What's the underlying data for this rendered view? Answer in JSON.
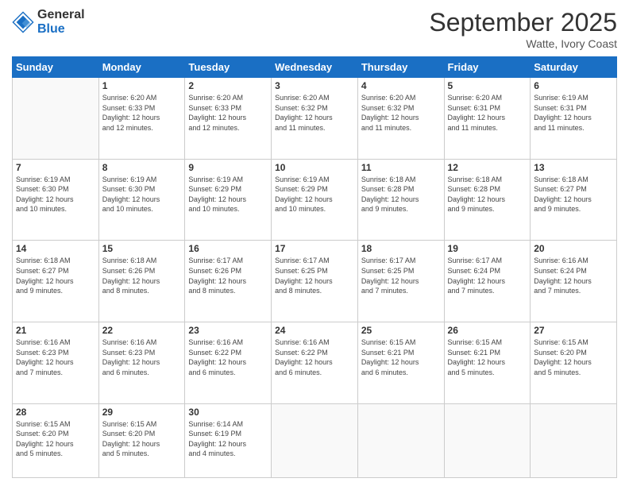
{
  "logo": {
    "general": "General",
    "blue": "Blue"
  },
  "header": {
    "title": "September 2025",
    "location": "Watte, Ivory Coast"
  },
  "weekdays": [
    "Sunday",
    "Monday",
    "Tuesday",
    "Wednesday",
    "Thursday",
    "Friday",
    "Saturday"
  ],
  "weeks": [
    [
      {
        "day": "",
        "info": ""
      },
      {
        "day": "1",
        "info": "Sunrise: 6:20 AM\nSunset: 6:33 PM\nDaylight: 12 hours\nand 12 minutes."
      },
      {
        "day": "2",
        "info": "Sunrise: 6:20 AM\nSunset: 6:33 PM\nDaylight: 12 hours\nand 12 minutes."
      },
      {
        "day": "3",
        "info": "Sunrise: 6:20 AM\nSunset: 6:32 PM\nDaylight: 12 hours\nand 11 minutes."
      },
      {
        "day": "4",
        "info": "Sunrise: 6:20 AM\nSunset: 6:32 PM\nDaylight: 12 hours\nand 11 minutes."
      },
      {
        "day": "5",
        "info": "Sunrise: 6:20 AM\nSunset: 6:31 PM\nDaylight: 12 hours\nand 11 minutes."
      },
      {
        "day": "6",
        "info": "Sunrise: 6:19 AM\nSunset: 6:31 PM\nDaylight: 12 hours\nand 11 minutes."
      }
    ],
    [
      {
        "day": "7",
        "info": "Sunrise: 6:19 AM\nSunset: 6:30 PM\nDaylight: 12 hours\nand 10 minutes."
      },
      {
        "day": "8",
        "info": "Sunrise: 6:19 AM\nSunset: 6:30 PM\nDaylight: 12 hours\nand 10 minutes."
      },
      {
        "day": "9",
        "info": "Sunrise: 6:19 AM\nSunset: 6:29 PM\nDaylight: 12 hours\nand 10 minutes."
      },
      {
        "day": "10",
        "info": "Sunrise: 6:19 AM\nSunset: 6:29 PM\nDaylight: 12 hours\nand 10 minutes."
      },
      {
        "day": "11",
        "info": "Sunrise: 6:18 AM\nSunset: 6:28 PM\nDaylight: 12 hours\nand 9 minutes."
      },
      {
        "day": "12",
        "info": "Sunrise: 6:18 AM\nSunset: 6:28 PM\nDaylight: 12 hours\nand 9 minutes."
      },
      {
        "day": "13",
        "info": "Sunrise: 6:18 AM\nSunset: 6:27 PM\nDaylight: 12 hours\nand 9 minutes."
      }
    ],
    [
      {
        "day": "14",
        "info": "Sunrise: 6:18 AM\nSunset: 6:27 PM\nDaylight: 12 hours\nand 9 minutes."
      },
      {
        "day": "15",
        "info": "Sunrise: 6:18 AM\nSunset: 6:26 PM\nDaylight: 12 hours\nand 8 minutes."
      },
      {
        "day": "16",
        "info": "Sunrise: 6:17 AM\nSunset: 6:26 PM\nDaylight: 12 hours\nand 8 minutes."
      },
      {
        "day": "17",
        "info": "Sunrise: 6:17 AM\nSunset: 6:25 PM\nDaylight: 12 hours\nand 8 minutes."
      },
      {
        "day": "18",
        "info": "Sunrise: 6:17 AM\nSunset: 6:25 PM\nDaylight: 12 hours\nand 7 minutes."
      },
      {
        "day": "19",
        "info": "Sunrise: 6:17 AM\nSunset: 6:24 PM\nDaylight: 12 hours\nand 7 minutes."
      },
      {
        "day": "20",
        "info": "Sunrise: 6:16 AM\nSunset: 6:24 PM\nDaylight: 12 hours\nand 7 minutes."
      }
    ],
    [
      {
        "day": "21",
        "info": "Sunrise: 6:16 AM\nSunset: 6:23 PM\nDaylight: 12 hours\nand 7 minutes."
      },
      {
        "day": "22",
        "info": "Sunrise: 6:16 AM\nSunset: 6:23 PM\nDaylight: 12 hours\nand 6 minutes."
      },
      {
        "day": "23",
        "info": "Sunrise: 6:16 AM\nSunset: 6:22 PM\nDaylight: 12 hours\nand 6 minutes."
      },
      {
        "day": "24",
        "info": "Sunrise: 6:16 AM\nSunset: 6:22 PM\nDaylight: 12 hours\nand 6 minutes."
      },
      {
        "day": "25",
        "info": "Sunrise: 6:15 AM\nSunset: 6:21 PM\nDaylight: 12 hours\nand 6 minutes."
      },
      {
        "day": "26",
        "info": "Sunrise: 6:15 AM\nSunset: 6:21 PM\nDaylight: 12 hours\nand 5 minutes."
      },
      {
        "day": "27",
        "info": "Sunrise: 6:15 AM\nSunset: 6:20 PM\nDaylight: 12 hours\nand 5 minutes."
      }
    ],
    [
      {
        "day": "28",
        "info": "Sunrise: 6:15 AM\nSunset: 6:20 PM\nDaylight: 12 hours\nand 5 minutes."
      },
      {
        "day": "29",
        "info": "Sunrise: 6:15 AM\nSunset: 6:20 PM\nDaylight: 12 hours\nand 5 minutes."
      },
      {
        "day": "30",
        "info": "Sunrise: 6:14 AM\nSunset: 6:19 PM\nDaylight: 12 hours\nand 4 minutes."
      },
      {
        "day": "",
        "info": ""
      },
      {
        "day": "",
        "info": ""
      },
      {
        "day": "",
        "info": ""
      },
      {
        "day": "",
        "info": ""
      }
    ]
  ]
}
